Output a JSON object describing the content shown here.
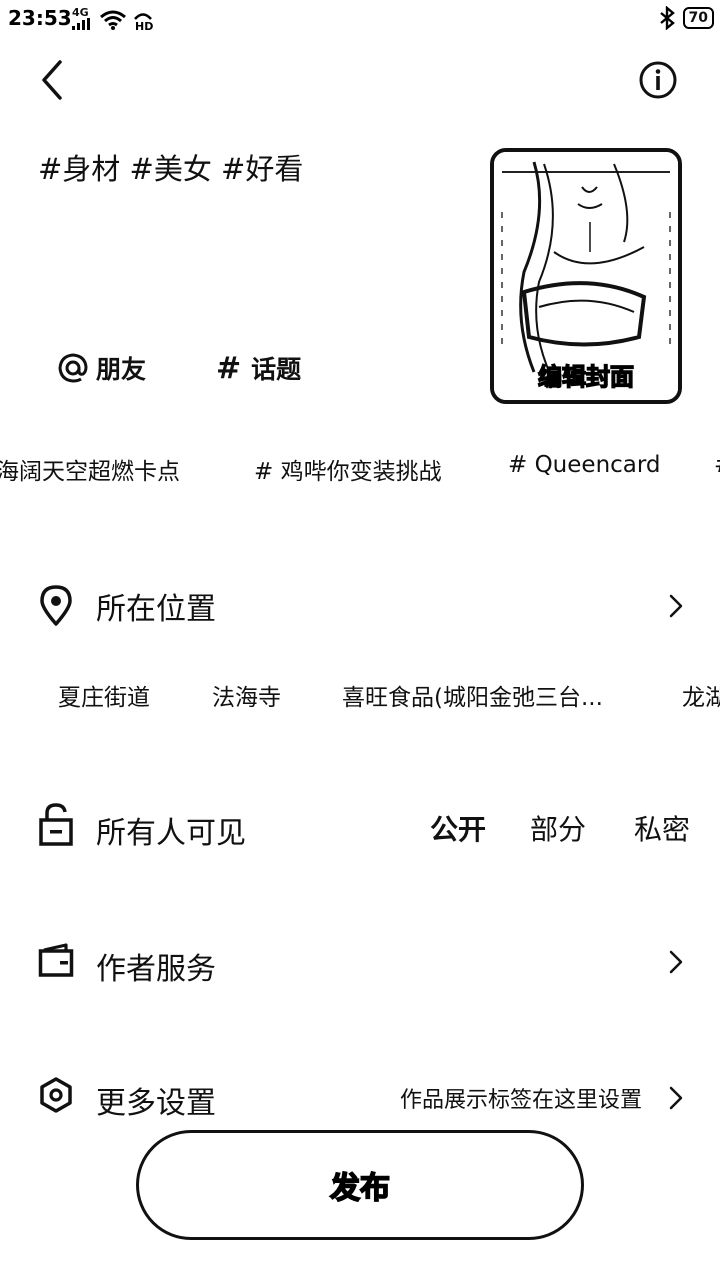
{
  "status_bar": {
    "time": "23:53",
    "network": "4G",
    "battery": "70"
  },
  "caption": "#身材 #美女 #好看",
  "cover": {
    "label": "编辑封面"
  },
  "compose_actions": {
    "mention_label": "朋友",
    "topic_label": "话题"
  },
  "hot_topics": [
    "海阔天空超燃卡点",
    "# 鸡哔你变装挑战",
    "# Queencard",
    "#"
  ],
  "location": {
    "title": "所在位置",
    "suggestions": [
      "夏庄街道",
      "法海寺",
      "喜旺食品(城阳金弛三台...",
      "龙湖"
    ]
  },
  "visibility": {
    "title": "所有人可见",
    "options": [
      "公开",
      "部分",
      "私密"
    ]
  },
  "author_services": {
    "title": "作者服务"
  },
  "more_settings": {
    "title": "更多设置",
    "hint": "作品展示标签在这里设置"
  },
  "publish": {
    "label": "发布"
  },
  "icons": {
    "back": "back-arrow-icon",
    "info": "info-icon",
    "at": "at-icon",
    "hash": "hash-icon",
    "location": "location-pin-icon",
    "lock": "unlock-icon",
    "wallet": "wallet-icon",
    "settings": "settings-hexagon-icon",
    "chevron": "chevron-right-icon"
  }
}
